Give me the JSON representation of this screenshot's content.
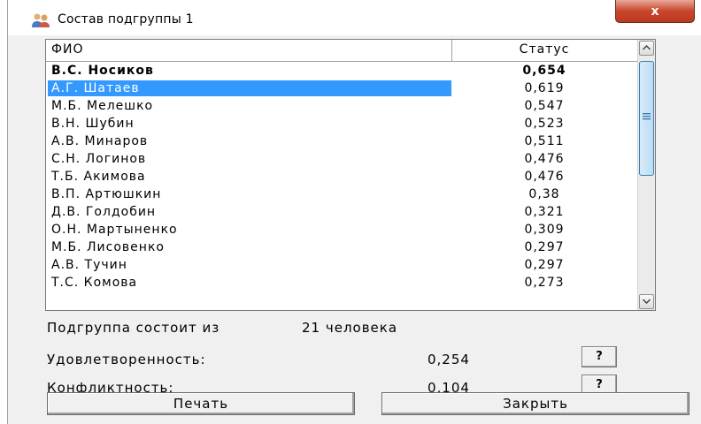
{
  "window": {
    "title": "Состав подгруппы 1",
    "close_label": "x"
  },
  "table": {
    "headers": {
      "name": "ФИО",
      "status": "Статус"
    },
    "rows": [
      {
        "name": "В.С. Носиков",
        "status": "0,654"
      },
      {
        "name": "А.Г. Шатаев",
        "status": "0,619"
      },
      {
        "name": "М.Б. Мелешко",
        "status": "0,547"
      },
      {
        "name": "В.Н. Шубин",
        "status": "0,523"
      },
      {
        "name": "А.В. Минаров",
        "status": "0,511"
      },
      {
        "name": "С.Н. Логинов",
        "status": "0,476"
      },
      {
        "name": "Т.Б. Акимова",
        "status": "0,476"
      },
      {
        "name": "В.П. Артюшкин",
        "status": "0,38"
      },
      {
        "name": "Д.В. Голдобин",
        "status": "0,321"
      },
      {
        "name": "О.Н. Мартыненко",
        "status": "0,309"
      },
      {
        "name": "М.Б. Лисовенко",
        "status": "0,297"
      },
      {
        "name": "А.В. Тучин",
        "status": "0,297"
      },
      {
        "name": "Т.С. Комова",
        "status": "0,273"
      }
    ]
  },
  "summary": {
    "group_label": "Подгруппа состоит из",
    "group_count": "21 человека",
    "satisfaction_label": "Удовлетворенность:",
    "satisfaction_value": "0,254",
    "conflict_label": "Конфликтность:",
    "conflict_value": "0,104",
    "help_label": "?"
  },
  "buttons": {
    "print": "Печать",
    "close": "Закрыть"
  },
  "colors": {
    "selection": "#3399ff",
    "close_button": "#c9462b"
  }
}
